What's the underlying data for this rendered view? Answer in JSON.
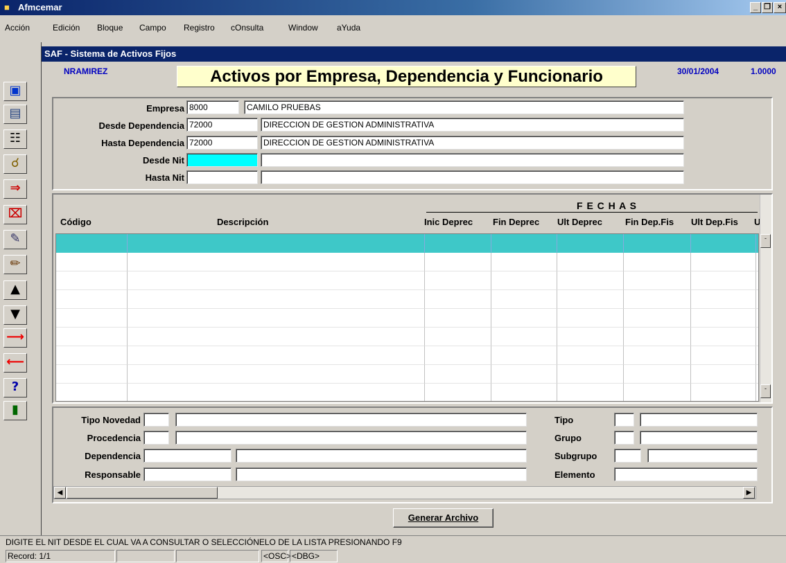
{
  "app": {
    "title": "Afmcemar"
  },
  "menu": [
    "Acción",
    "Edición",
    "Bloque",
    "Campo",
    "Registro",
    "cOnsulta",
    "Window",
    "aYuda"
  ],
  "window": {
    "title": "SAF - Sistema de Activos Fijos",
    "user": "NRAMIREZ",
    "form_title": "Activos por Empresa, Dependencia y Funcionario",
    "date": "30/01/2004",
    "version": "1.0000"
  },
  "filters": {
    "empresa": {
      "label": "Empresa",
      "code": "8000",
      "desc": "CAMILO PRUEBAS"
    },
    "desde_dependencia": {
      "label": "Desde Dependencia",
      "code": "72000",
      "desc": "DIRECCION DE GESTION ADMINISTRATIVA"
    },
    "hasta_dependencia": {
      "label": "Hasta Dependencia",
      "code": "72000",
      "desc": "DIRECCION DE GESTION ADMINISTRATIVA"
    },
    "desde_nit": {
      "label": "Desde Nit",
      "code": "",
      "desc": ""
    },
    "hasta_nit": {
      "label": "Hasta Nit",
      "code": "",
      "desc": ""
    }
  },
  "grid": {
    "group_header": "F E C H A S",
    "columns": [
      "Código",
      "Descripción",
      "Inic Deprec",
      "Fin Deprec",
      "Ult Deprec",
      "Fin Dep.Fis",
      "Ult Dep.Fis",
      "U"
    ],
    "rows": 9
  },
  "details": {
    "tipo_novedad": "Tipo Novedad",
    "procedencia": "Procedencia",
    "dependencia": "Dependencia",
    "responsable": "Responsable",
    "tipo": "Tipo",
    "grupo": "Grupo",
    "subgrupo": "Subgrupo",
    "elemento": "Elemento"
  },
  "buttons": {
    "generar": "Generar Archivo"
  },
  "status": {
    "hint": "DIGITE EL NIT DESDE EL CUAL VA A CONSULTAR O SELECCIÓNELO DE LA LISTA PRESIONANDO  F9",
    "record": "Record: 1/1",
    "osc": "<OSC>",
    "dbg": "<DBG>"
  },
  "toolbar_icons": [
    "save-icon",
    "form-icon",
    "clipboard-icon",
    "query-icon",
    "insert-record-icon",
    "delete-record-icon",
    "clear-icon",
    "edit-icon",
    "previous-block-icon",
    "next-block-icon",
    "next-record-icon",
    "previous-record-icon",
    "help-icon",
    "exit-icon"
  ]
}
